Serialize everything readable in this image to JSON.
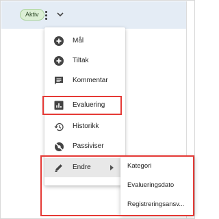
{
  "header": {
    "status_chip": "Aktiv",
    "more_icon": "more-vertical-icon",
    "expand_icon": "chevron-down-icon"
  },
  "menu": {
    "items": [
      {
        "label": "Mål",
        "icon": "add-circle-icon"
      },
      {
        "label": "Tiltak",
        "icon": "add-circle-icon"
      },
      {
        "label": "Kommentar",
        "icon": "comment-icon"
      },
      {
        "label": "Evaluering",
        "icon": "bar-chart-icon"
      },
      {
        "label": "Historikk",
        "icon": "history-icon"
      },
      {
        "label": "Passiviser",
        "icon": "visibility-off-icon"
      },
      {
        "label": "Endre",
        "icon": "edit-pencil-icon",
        "has_submenu": true
      }
    ]
  },
  "submenu": {
    "items": [
      {
        "label": "Kategori"
      },
      {
        "label": "Evalueringsdato"
      },
      {
        "label": "Registreringsansv..."
      }
    ]
  },
  "colors": {
    "header_bg": "#e4ecf5",
    "chip_bg": "#dcefd5",
    "highlight": "#e53935",
    "icon": "#444444"
  }
}
